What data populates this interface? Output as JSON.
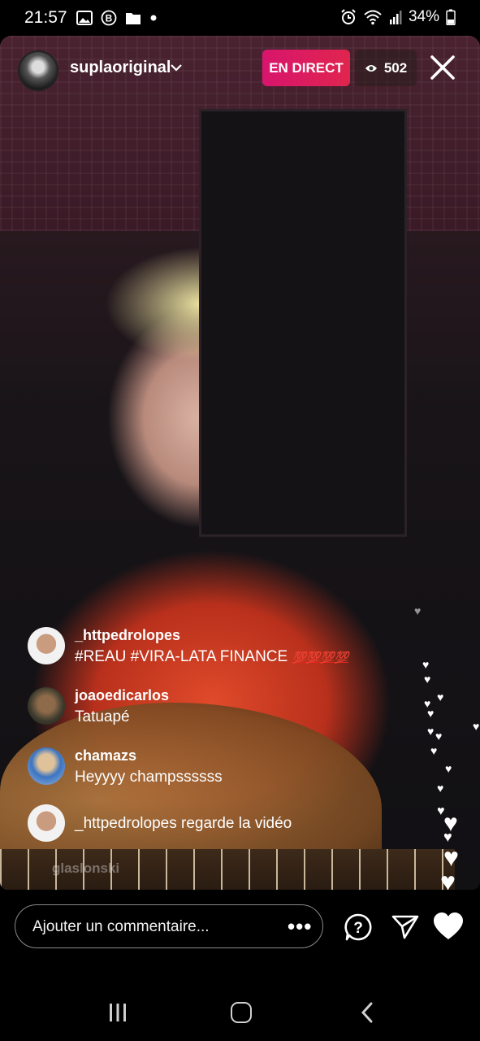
{
  "status_bar": {
    "time": "21:57",
    "battery": "34%"
  },
  "live": {
    "username": "suplaoriginal",
    "live_label": "EN DIRECT",
    "viewer_count": "502"
  },
  "comments": [
    {
      "user": "_httpedrolopes",
      "text": "#REAU #VIRA-LATA FINANCE",
      "emoji": "💯💯💯💯"
    },
    {
      "user": "joaoedicarlos",
      "text": "Tatuapé"
    },
    {
      "user": "chamazs",
      "text": "Heyyyy champssssss"
    }
  ],
  "join_notice": "_httpedrolopes regarde la vidéo",
  "faded_user": "glaslonski",
  "bottom_bar": {
    "comment_placeholder": "Ajouter un commentaire..."
  },
  "colors": {
    "live_badge": "#d8156d",
    "hundred_emoji": "#e2271b"
  },
  "icons": [
    "gallery-icon",
    "b-icon",
    "folder-icon",
    "alarm-icon",
    "wifi-icon",
    "signal-icon",
    "battery-icon",
    "chevron-down-icon",
    "eye-icon",
    "close-icon",
    "more-icon",
    "question-icon",
    "send-icon",
    "heart-icon",
    "recent-apps-icon",
    "home-icon",
    "back-icon"
  ]
}
